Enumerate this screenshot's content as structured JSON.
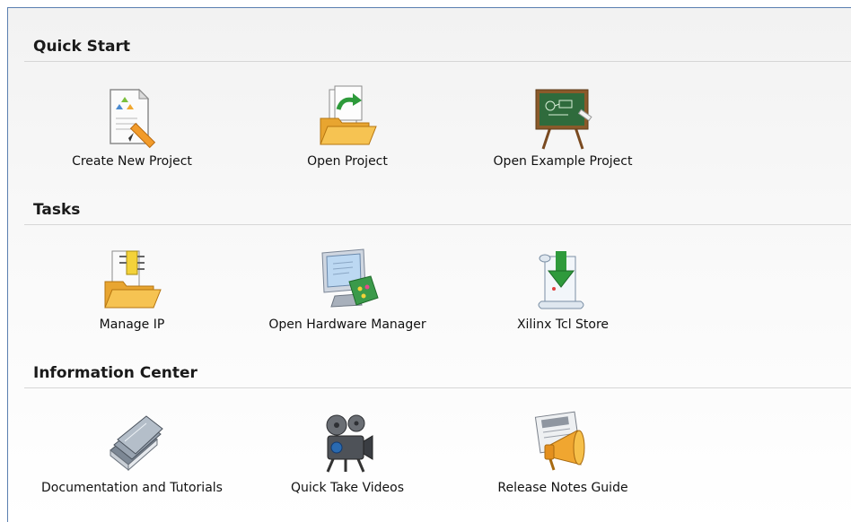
{
  "sections": [
    {
      "title": "Quick Start",
      "items": [
        {
          "label": "Create New Project",
          "icon": "new-project-icon"
        },
        {
          "label": "Open Project",
          "icon": "open-project-icon"
        },
        {
          "label": "Open Example Project",
          "icon": "example-project-icon"
        }
      ]
    },
    {
      "title": "Tasks",
      "items": [
        {
          "label": "Manage IP",
          "icon": "manage-ip-icon"
        },
        {
          "label": "Open Hardware Manager",
          "icon": "hardware-manager-icon"
        },
        {
          "label": "Xilinx Tcl Store",
          "icon": "tcl-store-icon"
        }
      ]
    },
    {
      "title": "Information Center",
      "items": [
        {
          "label": "Documentation and Tutorials",
          "icon": "documentation-icon"
        },
        {
          "label": "Quick Take Videos",
          "icon": "video-camera-icon"
        },
        {
          "label": "Release Notes Guide",
          "icon": "release-notes-icon"
        }
      ]
    }
  ],
  "colors": {
    "panel_border": "#5a7fb0",
    "rule": "#d6d6d6"
  }
}
